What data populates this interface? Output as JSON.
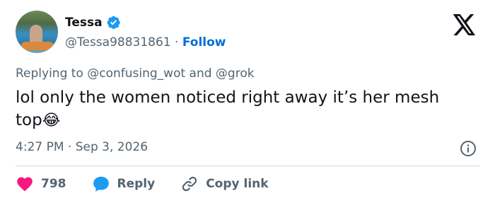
{
  "user": {
    "name": "Tessa",
    "handle": "@Tessa98831861",
    "separator": "·",
    "follow_label": "Follow"
  },
  "reply_to": "Replying to @confusing_wot and @grok",
  "tweet": {
    "text": "lol only the women noticed right away it’s her mesh top",
    "emoji": "😂"
  },
  "timestamp": "4:27 PM · Sep 3, 2026",
  "actions": {
    "like_count": "798",
    "reply_label": "Reply",
    "copy_label": "Copy link"
  },
  "icons": {
    "verified": "verified-badge-icon",
    "logo": "x-logo-icon",
    "info": "info-icon",
    "like": "heart-icon",
    "reply": "speech-bubble-icon",
    "copy": "link-icon"
  },
  "colors": {
    "accent": "#006fd6",
    "muted_text": "#536471",
    "like": "#f91880",
    "reply": "#1d9bf0"
  }
}
